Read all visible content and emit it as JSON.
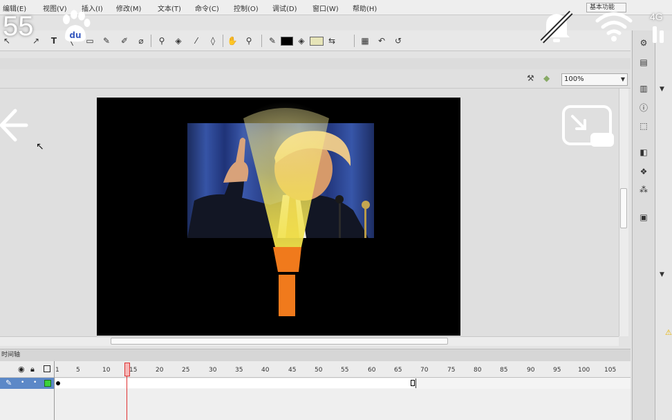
{
  "menus": [
    "编辑(E)",
    "视图(V)",
    "插入(I)",
    "修改(M)",
    "文本(T)",
    "命令(C)",
    "控制(O)",
    "调试(D)",
    "窗口(W)",
    "帮助(H)"
  ],
  "workspace_label": "基本功能",
  "zoom": "100%",
  "timeline": {
    "panel_title": "时间轴",
    "frame_numbers": [
      "1",
      "5",
      "10",
      "15",
      "20",
      "25",
      "30",
      "35",
      "40",
      "45",
      "50",
      "55",
      "60",
      "65",
      "70",
      "75",
      "80",
      "85",
      "90",
      "95",
      "100",
      "105"
    ],
    "current_frame": 14
  },
  "status_bar": {
    "time": "55",
    "network": "4G"
  },
  "icons": {
    "back": "arrow-left-icon",
    "pip": "picture-in-picture-icon",
    "mute": "bell-off-icon",
    "wifi": "wifi-icon",
    "baidu": "baidu-paw-icon"
  },
  "colors": {
    "stage": "#000000",
    "flashlight_body": "#f07a1c",
    "beam": "#f5e65a",
    "playhead": "#e03030",
    "layer_row": "#5c88c7"
  }
}
